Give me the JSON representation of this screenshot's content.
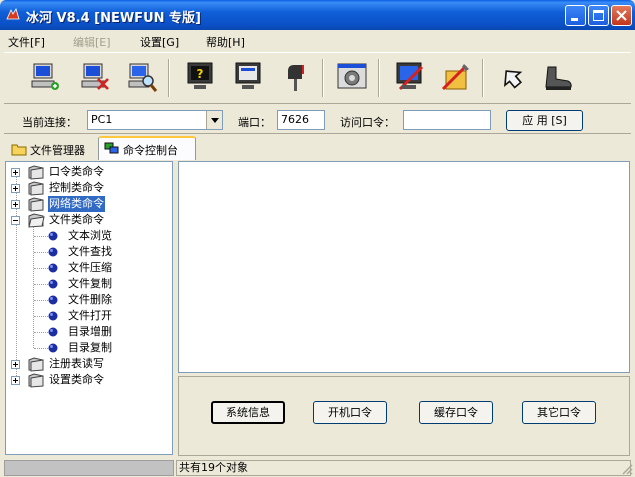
{
  "window": {
    "title": "冰河 V8.4 [NEWFUN 专版]"
  },
  "menu": {
    "items": [
      {
        "label": "文件[F]",
        "disabled": false
      },
      {
        "label": "编辑[E]",
        "disabled": true
      },
      {
        "label": "设置[G]",
        "disabled": false
      },
      {
        "label": "帮助[H]",
        "disabled": false
      }
    ]
  },
  "toolbar": {
    "icons": [
      "add-host-icon",
      "delete-host-icon",
      "search-host-icon",
      "help-monitor-icon",
      "screen-capture-icon",
      "mailbox-icon",
      "settings-icon",
      "config-tool-icon",
      "repair-tools-icon",
      "refresh-arrow-icon",
      "boot-icon"
    ]
  },
  "connection": {
    "current_label": "当前连接：",
    "current_value": "PC1",
    "port_label": "端口：",
    "port_value": "7626",
    "password_label": "访问口令：",
    "password_value": "",
    "apply_label": "应 用 [S]"
  },
  "tabs": [
    {
      "label": "文件管理器",
      "active": false
    },
    {
      "label": "命令控制台",
      "active": true
    }
  ],
  "tree": {
    "groups": [
      {
        "label": "口令类命令",
        "expanded": false,
        "selected": false
      },
      {
        "label": "控制类命令",
        "expanded": false,
        "selected": false
      },
      {
        "label": "网络类命令",
        "expanded": false,
        "selected": true
      },
      {
        "label": "文件类命令",
        "expanded": true,
        "selected": false,
        "children": [
          "文本浏览",
          "文件查找",
          "文件压缩",
          "文件复制",
          "文件删除",
          "文件打开",
          "目录增删",
          "目录复制"
        ]
      },
      {
        "label": "注册表读写",
        "expanded": false,
        "selected": false
      },
      {
        "label": "设置类命令",
        "expanded": false,
        "selected": false
      }
    ]
  },
  "commands": {
    "buttons": [
      "系统信息",
      "开机口令",
      "缓存口令",
      "其它口令"
    ]
  },
  "status": {
    "right_text": "共有19个对象"
  },
  "colors": {
    "titlebar": "#0b4fc4",
    "selection": "#316ac5",
    "window_bg": "#ece9d8"
  }
}
